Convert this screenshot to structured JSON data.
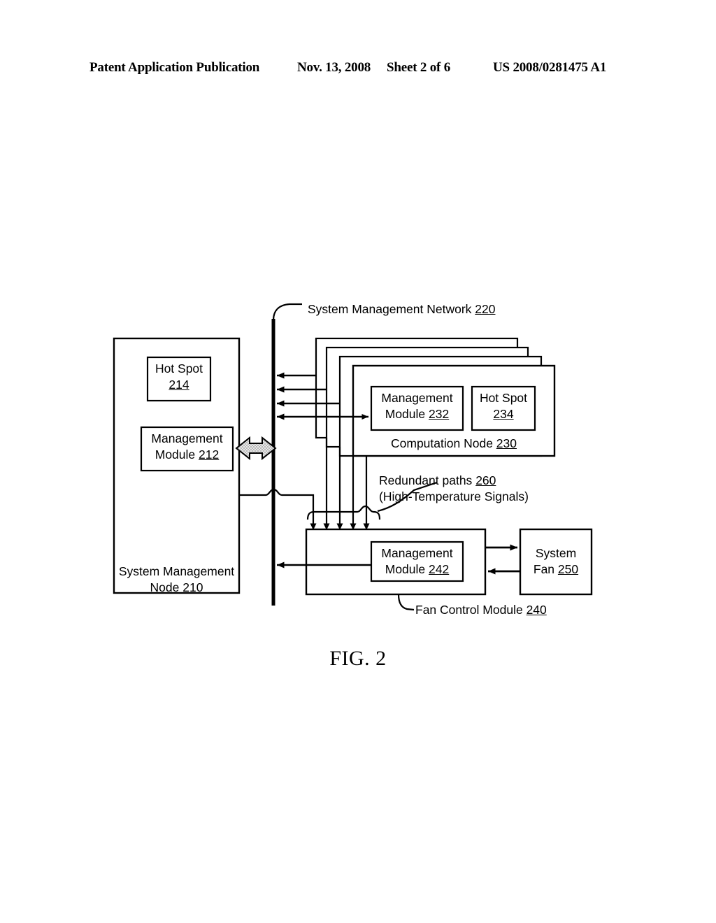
{
  "header": {
    "publication": "Patent Application Publication",
    "date": "Nov. 13, 2008",
    "sheet": "Sheet 2 of 6",
    "patent_number": "US 2008/0281475 A1"
  },
  "figure": {
    "number": "FIG. 2",
    "network_label": {
      "text": "System Management Network",
      "ref": "220"
    },
    "system_management_node": {
      "title": "System Management",
      "title_line2": "Node",
      "ref": "210",
      "hot_spot": {
        "line1": "Hot Spot",
        "ref": "214"
      },
      "management_module": {
        "line1": "Management",
        "line2": "Module",
        "ref": "212"
      }
    },
    "computation_node": {
      "title": "Computation Node",
      "ref": "230",
      "stack_count": 4,
      "management_module": {
        "line1": "Management",
        "line2": "Module",
        "ref": "232"
      },
      "hot_spot": {
        "line1": "Hot Spot",
        "ref": "234"
      }
    },
    "redundant_paths": {
      "line1": "Redundant paths",
      "ref": "260",
      "line2": "(High-Temperature Signals)"
    },
    "fan_control_module": {
      "title": "Fan Control Module",
      "ref": "240",
      "management_module": {
        "line1": "Management",
        "line2": "Module",
        "ref": "242"
      }
    },
    "system_fan": {
      "line1": "System",
      "line2": "Fan",
      "ref": "250"
    },
    "colors": {
      "stroke": "#000000",
      "background": "#ffffff",
      "bus_arrow_fill": "#d8d8d8"
    }
  }
}
